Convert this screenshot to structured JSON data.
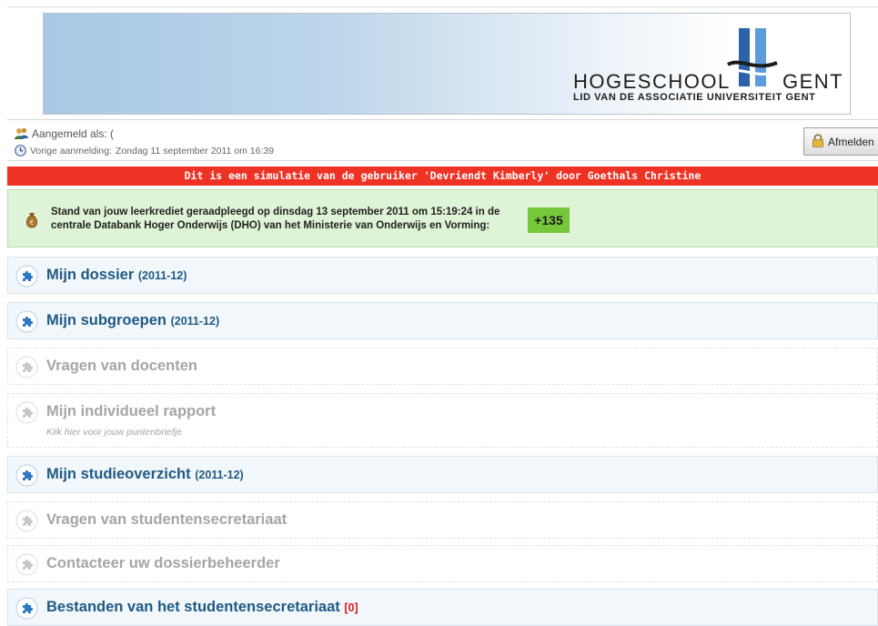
{
  "header": {
    "logo_name": "HOGESCHOOL",
    "logo_city": "GENT",
    "logo_tagline": "LID VAN DE ASSOCIATIE UNIVERSITEIT GENT"
  },
  "user_bar": {
    "logged_in_label": "Aangemeld als: (",
    "previous_login_label": "Vorige aanmelding:",
    "previous_login_value": "Zondag 11 september 2011 om 16:39",
    "logout_label": "Afmelden"
  },
  "simulation_notice": "Dit is een simulatie van de gebruiker 'Devriendt Kimberly' door Goethals Christine",
  "credit": {
    "text_line1": "Stand van jouw leerkrediet geraadpleegd op dinsdag 13 september 2011 om 15:19:24 in de",
    "text_line2": "centrale Databank Hoger Onderwijs (DHO) van het Ministerie van Onderwijs en Vorming:",
    "value": "+135"
  },
  "sections": [
    {
      "title": "Mijn dossier",
      "year": "(2011-12)",
      "active": true
    },
    {
      "title": "Mijn subgroepen",
      "year": "(2011-12)",
      "active": true
    },
    {
      "title": "Vragen van docenten",
      "active": false
    },
    {
      "title": "Mijn individueel rapport",
      "subtitle": "Klik hier voor jouw puntenbriefje",
      "active": false
    },
    {
      "title": "Mijn studieoverzicht",
      "year": "(2011-12)",
      "active": true
    },
    {
      "title": "Vragen van studentensecretariaat",
      "active": false
    },
    {
      "title": "Contacteer uw dossierbeheerder",
      "active": false
    },
    {
      "title": "Bestanden van het studentensecretariaat",
      "count": "[0]",
      "active": true
    }
  ],
  "colors": {
    "section_title_active": "#1f5a84",
    "section_title_inactive": "#a5a5a5",
    "simulation_bar": "#ee3224",
    "credit_background": "#dff3d6",
    "credit_value_background": "#77c73a",
    "count_red": "#d81c1c"
  },
  "icons": {
    "section_active": "puzzle-icon",
    "section_inactive": "puzzle-icon",
    "user": "users-icon",
    "previous_login": "clock-icon",
    "logout": "lock-icon",
    "credit": "money-bag-icon"
  }
}
